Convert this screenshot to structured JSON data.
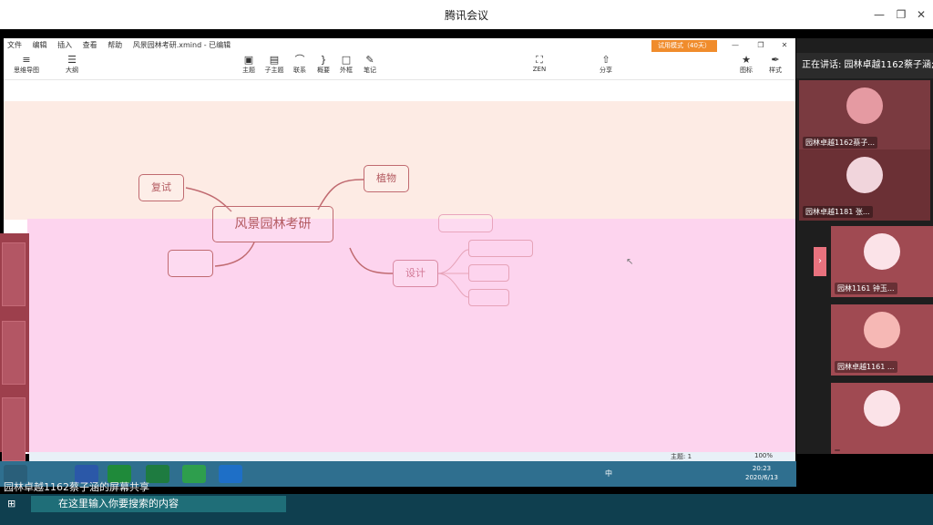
{
  "window": {
    "title": "腾讯会议"
  },
  "xmind": {
    "menu": [
      "文件",
      "编辑",
      "插入",
      "查看",
      "帮助",
      "风景园林考研.xmind - 已编辑"
    ],
    "trial_badge": "试用模式（40天）",
    "tools_left": [
      {
        "icon": "mindmap-icon",
        "label": "思维导图"
      },
      {
        "icon": "outline-icon",
        "label": "大纲"
      }
    ],
    "tools_center": [
      {
        "icon": "topic-icon",
        "label": "主题"
      },
      {
        "icon": "subtopic-icon",
        "label": "子主题"
      },
      {
        "icon": "relation-icon",
        "label": "联系"
      },
      {
        "icon": "summary-icon",
        "label": "概要"
      },
      {
        "icon": "boundary-icon",
        "label": "外框"
      },
      {
        "icon": "note-icon",
        "label": "笔记"
      }
    ],
    "zen_label": "ZEN",
    "share_label": "分享",
    "tools_right": [
      {
        "icon": "star-icon",
        "label": "图标"
      },
      {
        "icon": "brush-icon",
        "label": "样式"
      }
    ],
    "central_topic": "风景园林考研",
    "nodes": {
      "fushi": "复试",
      "zhiwu": "植物",
      "sheji": "设计",
      "left_lower": "",
      "right_upper": ""
    },
    "status": {
      "topic_count": "主题: 1",
      "zoom": "100%"
    }
  },
  "panel": {
    "speaking": "正在讲话: 园林卓越1162蔡子涵;",
    "participants": [
      {
        "name": "园林卓越1162蔡子..."
      },
      {
        "name": "园林卓越1181 张..."
      },
      {
        "name": "园林1161 钟玉..."
      },
      {
        "name": "园林卓越1161 ..."
      },
      {
        "name": ""
      }
    ]
  },
  "taskbar": {
    "time": "20:23",
    "date": "2020/6/13",
    "ime": "中"
  },
  "share_banner": "园林卓越1162蔡子涵的屏幕共享",
  "search_placeholder": "在这里输入你要搜索的内容",
  "colors": {
    "canvas_top": "#fdebe4",
    "canvas_bottom": "#fdd4ee",
    "node_border": "#c06a70",
    "trial_orange": "#f08c2c",
    "taskbar": "#2f6f8f"
  }
}
